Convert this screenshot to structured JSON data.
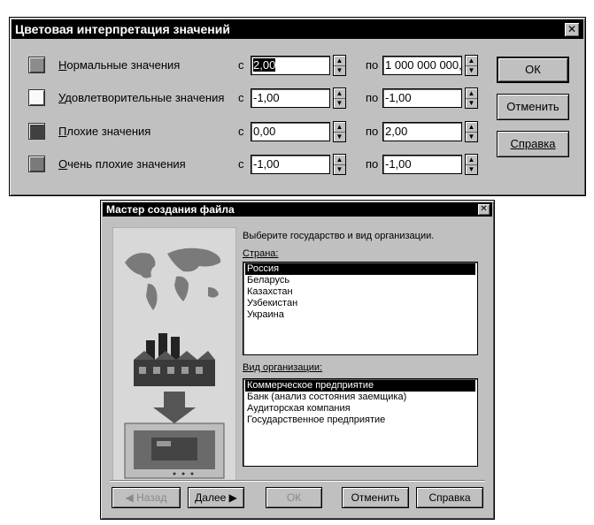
{
  "color_dialog": {
    "title": "Цветовая интерпретация значений",
    "rows": [
      {
        "label": "Нормальные значения",
        "accel": "Н",
        "rest": "ормальные значения",
        "from_prefix": "с",
        "from_value": "2,00",
        "to_prefix": "по",
        "to_value": "1 000 000 000,",
        "swatch": "#8c8c8c"
      },
      {
        "label": "Удовлетворительные значения",
        "accel": "У",
        "rest": "довлетворительные значения",
        "from_prefix": "с",
        "from_value": "-1,00",
        "to_prefix": "по",
        "to_value": "-1,00",
        "swatch": "#fafafa"
      },
      {
        "label": "Плохие значения",
        "accel": "П",
        "rest": "лохие значения",
        "from_prefix": "с",
        "from_value": "0,00",
        "to_prefix": "по",
        "to_value": "2,00",
        "swatch": "#404040"
      },
      {
        "label": "Очень плохие значения",
        "accel": "О",
        "rest": "чень плохие значения",
        "from_prefix": "с",
        "from_value": "-1,00",
        "to_prefix": "по",
        "to_value": "-1,00",
        "swatch": "#7a7a7a"
      }
    ],
    "buttons": {
      "ok": "ОК",
      "cancel": "Отменить",
      "help": "Справка"
    }
  },
  "wizard": {
    "title": "Мастер создания файла",
    "instruction": "Выберите государство и вид организации.",
    "country_label": "Страна:",
    "countries": [
      "Россия",
      "Беларусь",
      "Казахстан",
      "Узбекистан",
      "Украина"
    ],
    "selected_country": "Россия",
    "org_label": "Вид организации:",
    "orgs": [
      "Коммерческое предприятие",
      "Банк (анализ состояния заемщика)",
      "Аудиторская компания",
      "Государственное предприятие"
    ],
    "selected_org": "Коммерческое предприятие",
    "buttons": {
      "back": "◀ Назад",
      "next": "Далее ▶",
      "ok": "ОК",
      "cancel": "Отменить",
      "help": "Справка"
    }
  },
  "icons": {
    "close": "close-icon",
    "spin_up": "arrow-up-icon",
    "spin_down": "arrow-down-icon"
  }
}
